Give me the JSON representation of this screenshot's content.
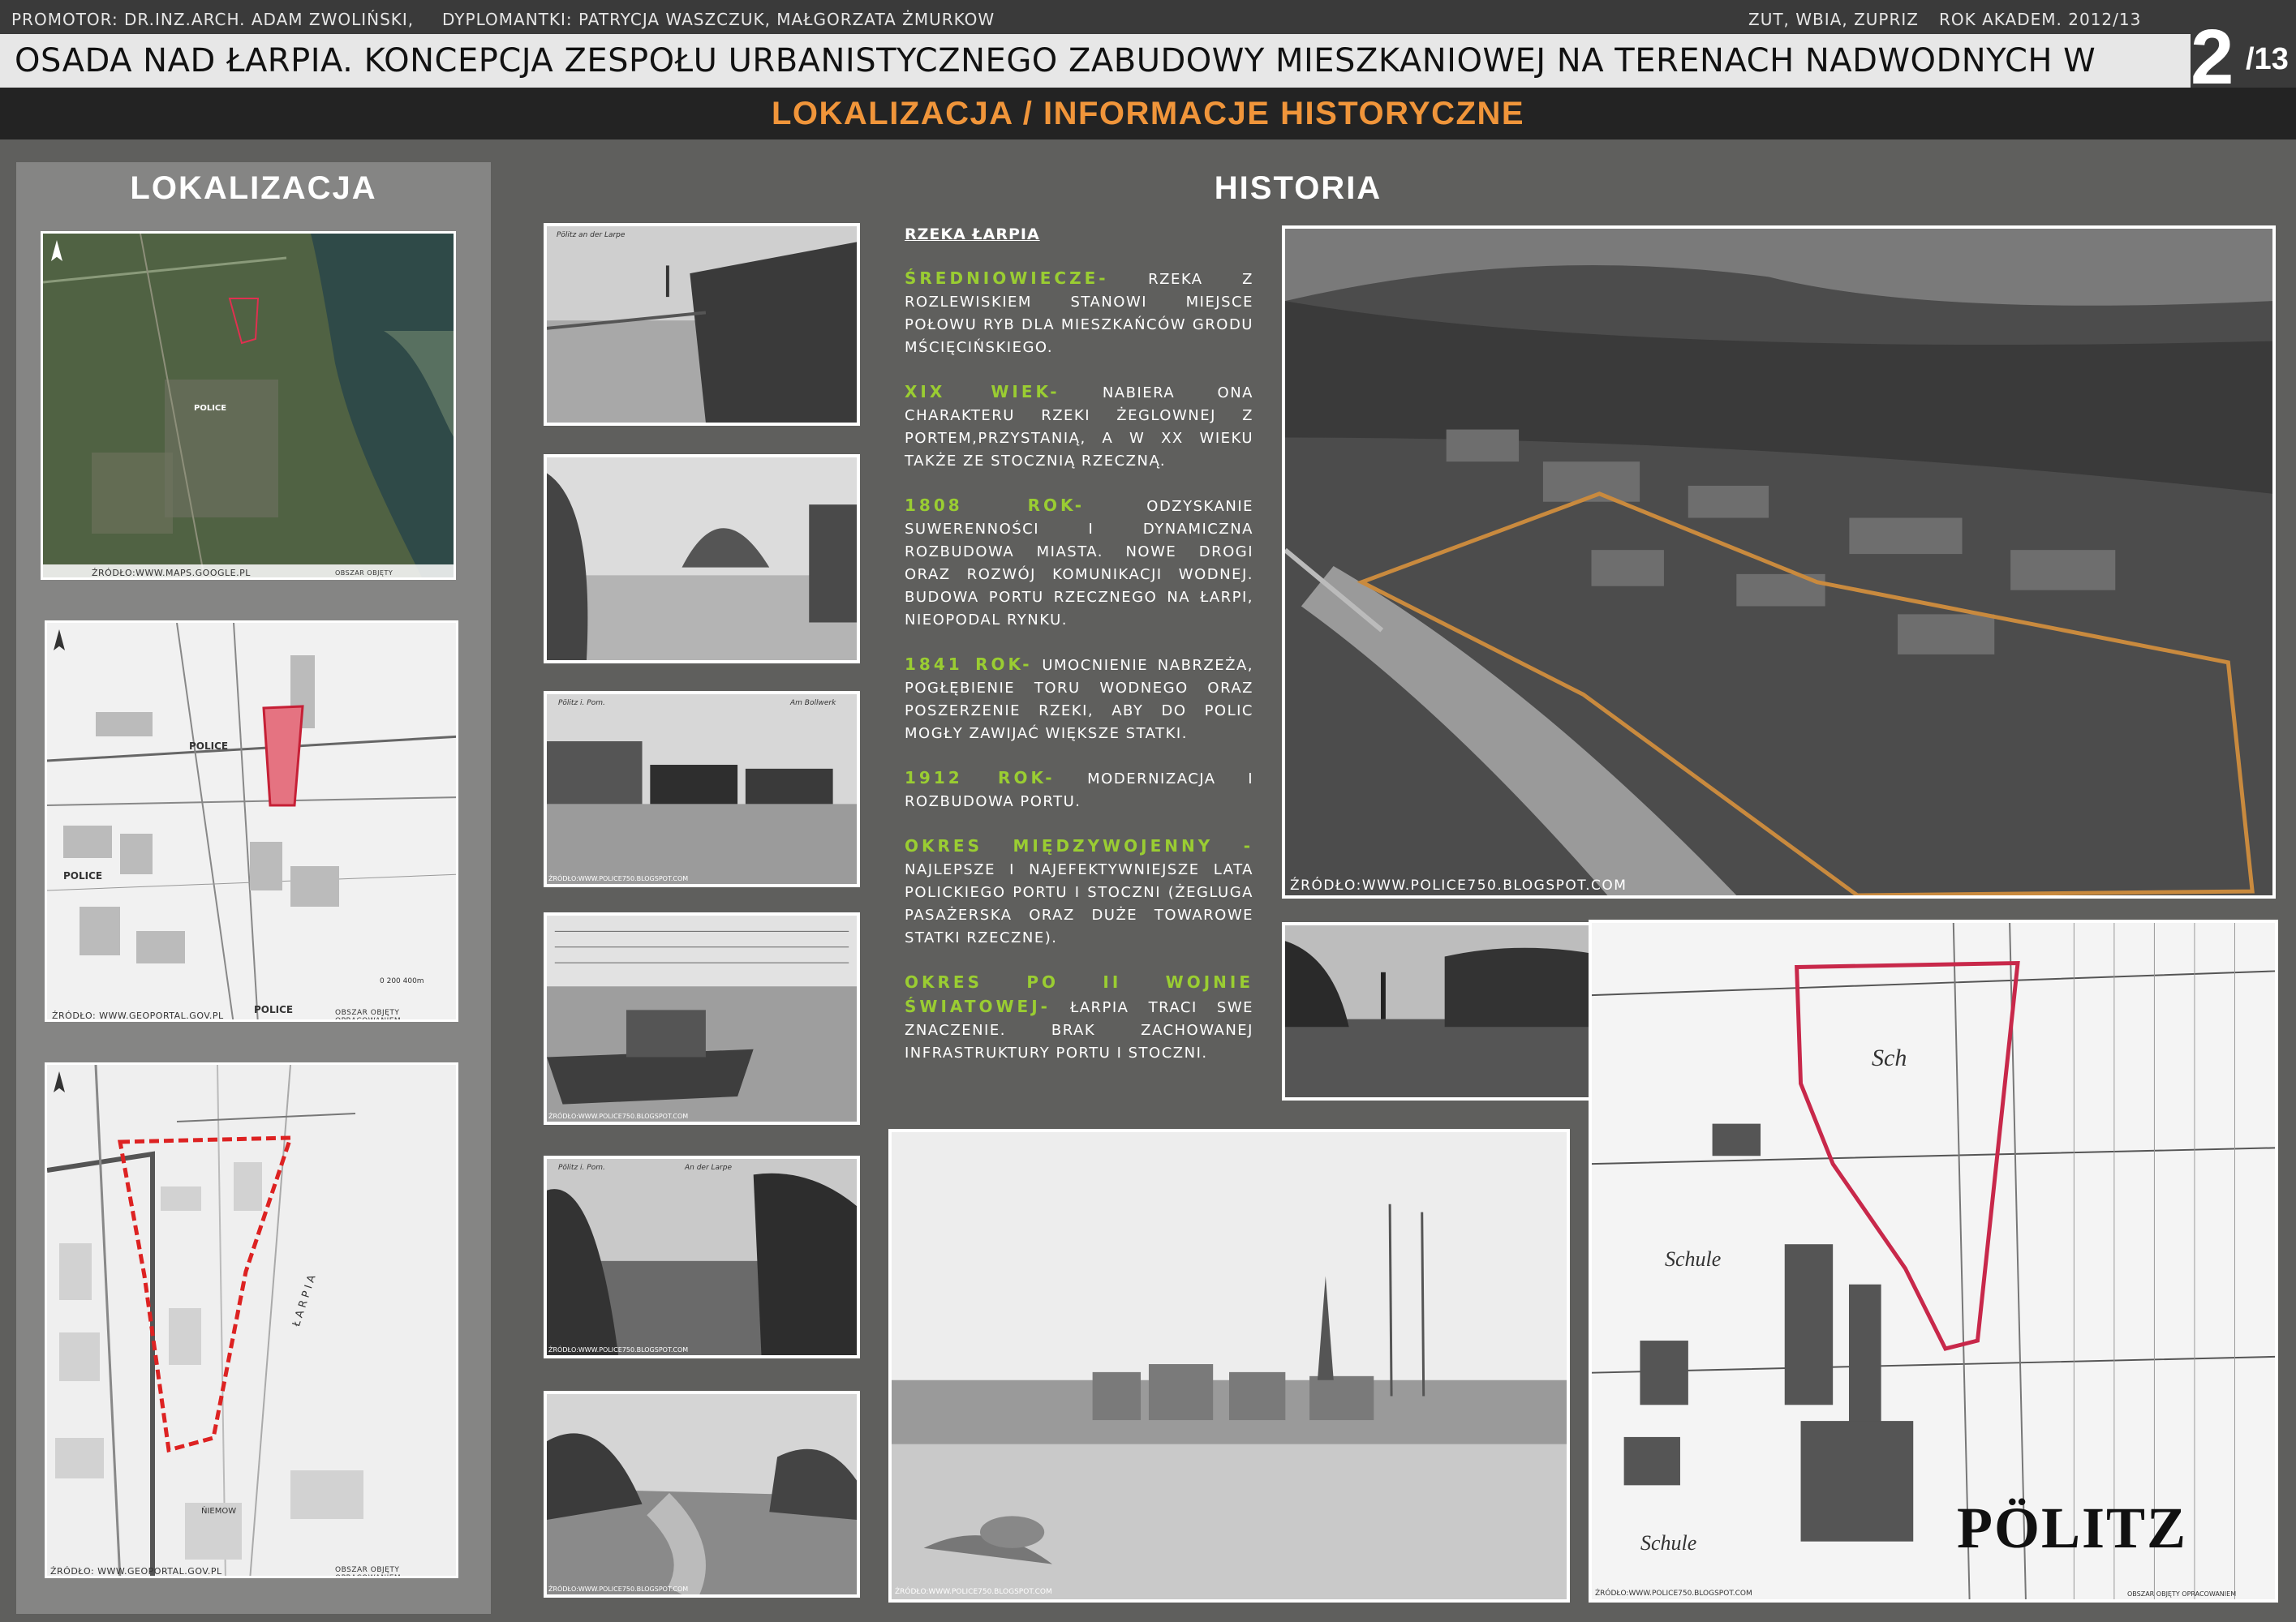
{
  "header": {
    "promotor": "PROMOTOR: DR.INZ.ARCH. ADAM ZWOLIŃSKI,",
    "authors": "DYPLOMANTKI: PATRYCJA WASZCZUK, MAŁGORZATA ŻMURKOW",
    "institution": "ZUT, WBIA, ZUPRIZ",
    "year": "ROK  AKADEM.  2012/13",
    "title": "OSADA NAD ŁARPIA. KONCEPCJA ZESPOŁU  URBANISTYCZNEGO  ZABUDOWY MIESZKANIOWEJ NA TERENACH NADWODNYCH W POLICACH.",
    "page_number": "2",
    "page_total": "/13",
    "section_title": "LOKALIZACJA / INFORMACJE HISTORYCZNE"
  },
  "colors": {
    "background": "#5f5f5d",
    "accent_orange": "#f0953a",
    "accent_green": "#9acd32",
    "boundary_red": "#cc2244"
  },
  "localization": {
    "heading": "LOKALIZACJA",
    "map1": {
      "label_police": "POLICE",
      "source": "ŹRÓDŁO:WWW.MAPS.GOOGLE.PL",
      "legend": "OBSZAR OBJĘTY OPRACOWANIEM"
    },
    "map2": {
      "label_police": "POLICE",
      "label_police2": "POLICE",
      "label_police3": "POLICE",
      "scale": "0    200    400m",
      "source": "ŹRÓDŁO: WWW.GEOPORTAL.GOV.PL",
      "legend": "OBSZAR OBJĘTY OPRACOWANIEM"
    },
    "map3": {
      "river_label": "ŁARPIA",
      "street_label": "ŃIEMOW",
      "source": "ŹRÓDŁO: WWW.GEOPORTAL.GOV.PL",
      "legend": "OBSZAR OBJĘTY OPRACOWANIEM"
    }
  },
  "history": {
    "heading": "HISTORIA",
    "river": "RZEKA ŁARPIA",
    "paragraphs": [
      {
        "head": "ŚREDNIOWIECZE-",
        "body": " RZEKA Z ROZLEWISKIEM STANOWI MIEJSCE POŁOWU RYB DLA MIESZKAŃCÓW GRODU MŚCIĘCIŃSKIEGO."
      },
      {
        "head": "XIX WIEK-",
        "body": " NABIERA ONA CHARAKTERU RZEKI ŻEGLOWNEJ Z PORTEM,PRZYSTANIĄ, A W XX WIEKU TAKŻE ZE STOCZNIĄ RZECZNĄ."
      },
      {
        "head": "1808 ROK-",
        "body": " ODZYSKANIE SUWERENNOŚCI I DYNAMICZNA ROZBUDOWA MIASTA. NOWE DROGI ORAZ ROZWÓJ KOMUNIKACJI WODNEJ. BUDOWA PORTU RZECZNEGO NA ŁARPI, NIEOPODAL RYNKU."
      },
      {
        "head": "1841 ROK-",
        "body": " UMOCNIENIE NABRZEŻA, POGŁĘBIENIE TORU WODNEGO ORAZ POSZERZENIE RZEKI, ABY DO POLIC MOGŁY ZAWIJAĆ WIĘKSZE STATKI."
      },
      {
        "head": "1912 ROK-",
        "body": " MODERNIZACJA I ROZBUDOWA PORTU."
      },
      {
        "head": "OKRES MIĘDZYWOJENNY -",
        "body": " NAJLEPSZE I NAJEFEKTYWNIEJSZE LATA POLICKIEGO PORTU I STOCZNI (ŻEGLUGA PASAŻERSKA ORAZ DUŻE TOWAROWE STATKI RZECZNE)."
      },
      {
        "head": "OKRES PO II WOJNIE ŚWIATOWEJ-",
        "body": " ŁARPIA TRACI SWE ZNACZENIE. BRAK ZACHOWANEJ INFRASTRUKTURY PORTU I STOCZNI."
      }
    ],
    "photo_sources": {
      "p3": "ŹRÓDŁO:WWW.POLICE750.BLOGSPOT.COM",
      "p4": "ŹRÓDŁO:WWW.POLICE750.BLOGSPOT.COM",
      "p5": "ŹRÓDŁO:WWW.POLICE750.BLOGSPOT.COM",
      "p6": "ŹRÓDŁO:WWW.POLICE750.BLOGSPOT.COM",
      "aerial": "ŹRÓDŁO:WWW.POLICE750.BLOGSPOT.COM",
      "engraving": "ŹRÓDŁO:WWW.POLICE750.BLOGSPOT.COM",
      "oldmap": "ŹRÓDŁO:WWW.POLICE750.BLOGSPOT.COM"
    },
    "photo_captions": {
      "p1_caption": "Pölitz an der Larpe",
      "p3_caption1": "Pölitz i. Pom.",
      "p3_caption2": "Am Bollwerk",
      "p5_caption1": "Pölitz i. Pom.",
      "p5_caption2": "An der Larpe"
    },
    "oldmap": {
      "town": "PÖLITZ",
      "label_sch": "Sch",
      "label_schule": "Schule",
      "label_schule2": "Schule",
      "legend": "OBSZAR OBJĘTY OPRACOWANIEM"
    }
  }
}
